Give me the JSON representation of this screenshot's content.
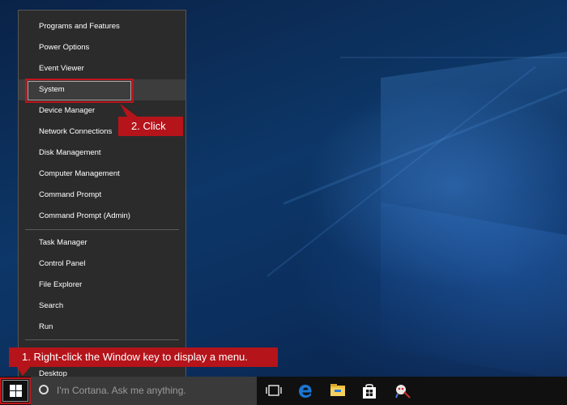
{
  "menu": {
    "items_group1": [
      "Programs and Features",
      "Power Options",
      "Event Viewer",
      "System",
      "Device Manager",
      "Network Connections",
      "Disk Management",
      "Computer Management",
      "Command Prompt",
      "Command Prompt (Admin)"
    ],
    "items_group2": [
      "Task Manager",
      "Control Panel",
      "File Explorer",
      "Search",
      "Run"
    ],
    "items_group3": [
      "Desktop"
    ],
    "highlighted_item": "System"
  },
  "callouts": {
    "step1": "1. Right-click the Window key to display a menu.",
    "step2": "2. Click"
  },
  "taskbar": {
    "search_placeholder": "I'm Cortana. Ask me anything.",
    "icons": [
      "windows-start-icon",
      "task-view-icon",
      "edge-browser-icon",
      "file-explorer-icon",
      "store-icon",
      "remote-support-icon"
    ]
  },
  "colors": {
    "menu_bg": "#2b2b2b",
    "callout_red": "#b5141a",
    "taskbar_bg": "#101010",
    "edge_blue": "#1b76d3",
    "folder_yellow": "#f0c23b"
  }
}
